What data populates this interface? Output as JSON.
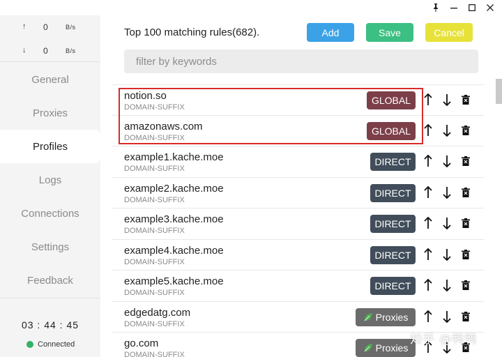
{
  "window": {
    "controls": [
      {
        "name": "pin-icon",
        "glyph": "📌"
      },
      {
        "name": "minimize-icon",
        "glyph": "—"
      },
      {
        "name": "maximize-icon",
        "glyph": "☐"
      },
      {
        "name": "close-icon",
        "glyph": "✕"
      }
    ]
  },
  "sidebar": {
    "traffic": {
      "upload": {
        "arrow": "↑",
        "value": "0",
        "unit": "B/s"
      },
      "download": {
        "arrow": "↓",
        "value": "0",
        "unit": "B/s"
      }
    },
    "items": [
      {
        "label": "General"
      },
      {
        "label": "Proxies"
      },
      {
        "label": "Profiles"
      },
      {
        "label": "Logs"
      },
      {
        "label": "Connections"
      },
      {
        "label": "Settings"
      },
      {
        "label": "Feedback"
      }
    ],
    "active_index": 2,
    "clock": "03 : 44 : 45",
    "status": "Connected",
    "status_color": "#2fb26a"
  },
  "main": {
    "title": "Top 100 matching rules(682).",
    "buttons": {
      "add": "Add",
      "save": "Save",
      "cancel": "Cancel"
    },
    "search": {
      "placeholder": "filter by keywords",
      "value": ""
    },
    "rules": [
      {
        "domain": "notion.so",
        "type": "DOMAIN-SUFFIX",
        "policy": "GLOBAL"
      },
      {
        "domain": "amazonaws.com",
        "type": "DOMAIN-SUFFIX",
        "policy": "GLOBAL"
      },
      {
        "domain": "example1.kache.moe",
        "type": "DOMAIN-SUFFIX",
        "policy": "DIRECT"
      },
      {
        "domain": "example2.kache.moe",
        "type": "DOMAIN-SUFFIX",
        "policy": "DIRECT"
      },
      {
        "domain": "example3.kache.moe",
        "type": "DOMAIN-SUFFIX",
        "policy": "DIRECT"
      },
      {
        "domain": "example4.kache.moe",
        "type": "DOMAIN-SUFFIX",
        "policy": "DIRECT"
      },
      {
        "domain": "example5.kache.moe",
        "type": "DOMAIN-SUFFIX",
        "policy": "DIRECT"
      },
      {
        "domain": "edgedatg.com",
        "type": "DOMAIN-SUFFIX",
        "policy": "Proxies"
      },
      {
        "domain": "go.com",
        "type": "DOMAIN-SUFFIX",
        "policy": "Proxies"
      }
    ],
    "actions": {
      "up": "↑",
      "down": "↓",
      "delete": "🗑"
    }
  },
  "colors": {
    "add": "#3ba2e8",
    "save": "#3cbf82",
    "cancel": "#e7e23a",
    "global": "#7c3f4a",
    "direct": "#414d5a",
    "proxies": "#6b6b6b",
    "highlight": "#d82a2a"
  },
  "watermark": "知乎 @鸭鸭"
}
